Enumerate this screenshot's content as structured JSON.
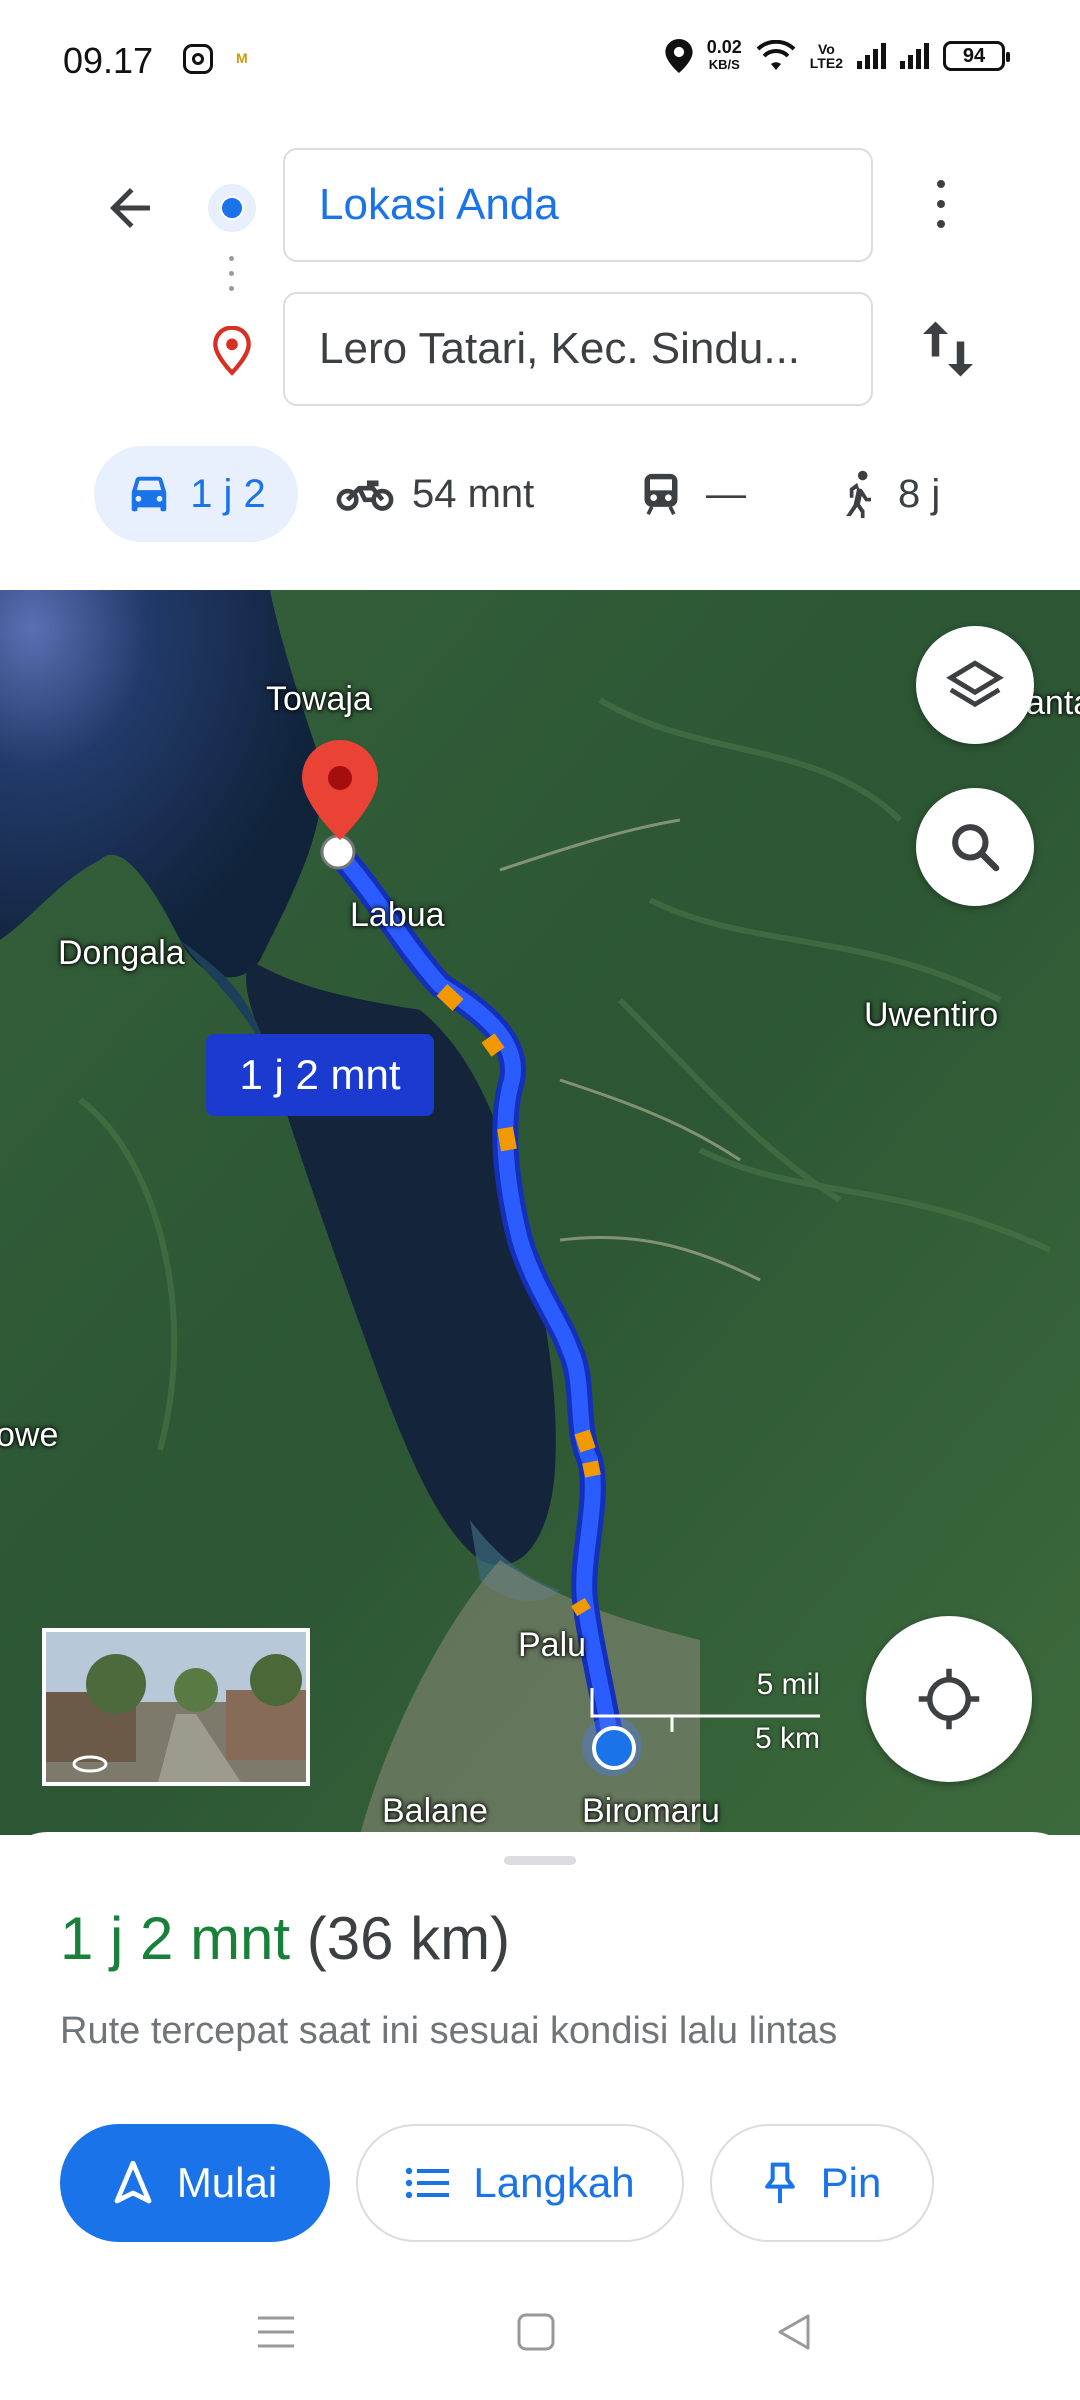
{
  "status_bar": {
    "time": "09.17",
    "mini_app": "M",
    "net_speed_value": "0.02",
    "net_speed_unit": "KB/S",
    "volte_top": "Vo",
    "volte_bottom": "LTE2",
    "battery": "94"
  },
  "directions": {
    "origin": "Lokasi Anda",
    "destination": "Lero Tatari, Kec. Sindu..."
  },
  "modes": {
    "car": "1 j 2",
    "motorbike": "54 mnt",
    "transit": "—",
    "walk": "8 j"
  },
  "map": {
    "labels": {
      "towaja": "Towaja",
      "labua": "Labua",
      "dongala": "Dongala",
      "uwentiro": "Uwentiro",
      "owe": "owe",
      "anta": "anta",
      "palu": "Palu",
      "balane": "Balane",
      "biromaru": "Biromaru"
    },
    "eta_badge": "1 j 2 mnt",
    "scale_mi": "5 mil",
    "scale_km": "5 km"
  },
  "summary": {
    "duration": "1 j 2 mnt",
    "distance": "(36 km)",
    "description": "Rute tercepat saat ini sesuai kondisi lalu lintas"
  },
  "actions": {
    "start": "Mulai",
    "steps": "Langkah",
    "pin": "Pin"
  },
  "colors": {
    "accent": "#1a73e8",
    "duration_green": "#188038",
    "route_blue": "#1a3ad0",
    "traffic_orange": "#f29900",
    "destination_red": "#ea4335"
  }
}
